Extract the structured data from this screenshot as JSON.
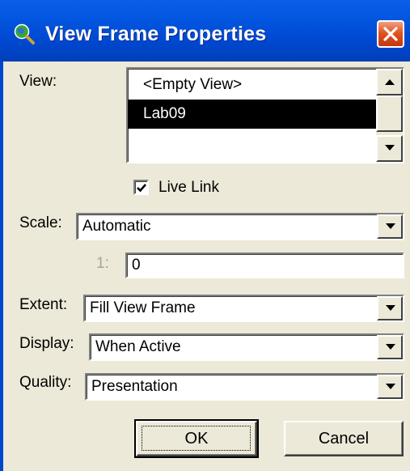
{
  "window": {
    "title": "View Frame Properties"
  },
  "view": {
    "label": "View:",
    "items": [
      "<Empty View>",
      "Lab09",
      ""
    ],
    "selected_index": 1
  },
  "live_link": {
    "label": "Live Link",
    "checked": true
  },
  "scale": {
    "label": "Scale:",
    "value": "Automatic",
    "ratio_prefix": "1:",
    "ratio_value": "0"
  },
  "extent": {
    "label": "Extent:",
    "value": "Fill View Frame"
  },
  "display": {
    "label": "Display:",
    "value": "When Active"
  },
  "quality": {
    "label": "Quality:",
    "value": "Presentation"
  },
  "buttons": {
    "ok": "OK",
    "cancel": "Cancel"
  },
  "colors": {
    "titlebar": "#0054e3",
    "close": "#e2541f",
    "dialog": "#ece9d8",
    "selection": "#000000"
  },
  "icons": [
    "globe-magnifier-icon",
    "close-icon",
    "scroll-up-icon",
    "scroll-down-icon",
    "checkmark-icon",
    "dropdown-arrow-icon"
  ]
}
